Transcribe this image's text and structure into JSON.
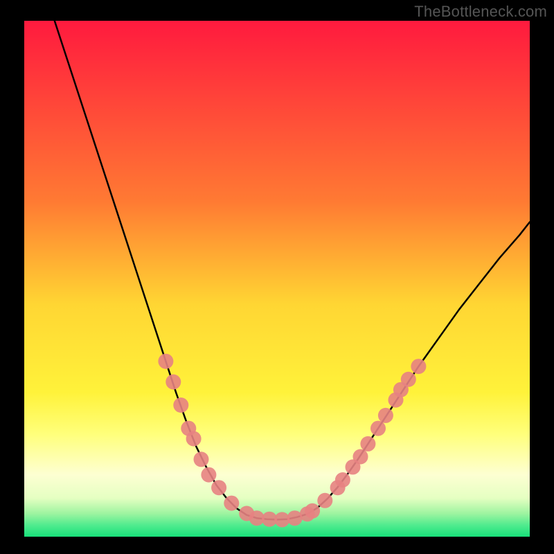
{
  "watermark": "TheBottleneck.com",
  "chart_data": {
    "type": "line",
    "title": "",
    "xlabel": "",
    "ylabel": "",
    "xlim": [
      0,
      100
    ],
    "ylim": [
      0,
      100
    ],
    "grid": false,
    "legend": false,
    "background_gradient": {
      "direction": "vertical",
      "stops": [
        {
          "pos": 0.0,
          "color": "#ff1a3e"
        },
        {
          "pos": 0.35,
          "color": "#ff7a33"
        },
        {
          "pos": 0.55,
          "color": "#ffd633"
        },
        {
          "pos": 0.72,
          "color": "#fff23a"
        },
        {
          "pos": 0.8,
          "color": "#ffff7a"
        },
        {
          "pos": 0.88,
          "color": "#fdffd2"
        },
        {
          "pos": 0.925,
          "color": "#e5ffc2"
        },
        {
          "pos": 0.955,
          "color": "#9ef4a0"
        },
        {
          "pos": 0.978,
          "color": "#4feb8e"
        },
        {
          "pos": 1.0,
          "color": "#18e07a"
        }
      ]
    },
    "series": [
      {
        "name": "left-curve",
        "color": "#000000",
        "x": [
          6,
          10,
          14,
          18,
          22,
          26,
          28,
          30,
          32,
          34,
          36,
          38,
          40,
          42,
          44,
          46
        ],
        "y": [
          100,
          88,
          76,
          64,
          52,
          40,
          34,
          28,
          22.5,
          17.5,
          13.5,
          10,
          7.5,
          5.5,
          4.2,
          3.6
        ]
      },
      {
        "name": "bottom-flat",
        "color": "#000000",
        "x": [
          46,
          48,
          50,
          52,
          54,
          56
        ],
        "y": [
          3.6,
          3.4,
          3.3,
          3.4,
          3.8,
          4.4
        ]
      },
      {
        "name": "right-curve",
        "color": "#000000",
        "x": [
          56,
          58,
          60,
          62,
          64,
          66,
          70,
          74,
          78,
          82,
          86,
          90,
          94,
          98,
          100
        ],
        "y": [
          4.4,
          5.6,
          7.4,
          9.6,
          12.2,
          15,
          21,
          27,
          33,
          38.5,
          44,
          49,
          54,
          58.5,
          61
        ]
      }
    ],
    "scatter": {
      "name": "markers",
      "color": "#e78282",
      "radius": 11,
      "points": [
        {
          "x": 28.0,
          "y": 34.0
        },
        {
          "x": 29.5,
          "y": 30.0
        },
        {
          "x": 31.0,
          "y": 25.5
        },
        {
          "x": 32.5,
          "y": 21.0
        },
        {
          "x": 33.5,
          "y": 19.0
        },
        {
          "x": 35.0,
          "y": 15.0
        },
        {
          "x": 36.5,
          "y": 12.0
        },
        {
          "x": 38.5,
          "y": 9.5
        },
        {
          "x": 41.0,
          "y": 6.5
        },
        {
          "x": 44.0,
          "y": 4.5
        },
        {
          "x": 46.0,
          "y": 3.6
        },
        {
          "x": 48.5,
          "y": 3.4
        },
        {
          "x": 51.0,
          "y": 3.3
        },
        {
          "x": 53.5,
          "y": 3.6
        },
        {
          "x": 56.0,
          "y": 4.4
        },
        {
          "x": 57.0,
          "y": 5.0
        },
        {
          "x": 59.5,
          "y": 7.0
        },
        {
          "x": 62.0,
          "y": 9.5
        },
        {
          "x": 63.0,
          "y": 11.0
        },
        {
          "x": 65.0,
          "y": 13.5
        },
        {
          "x": 66.5,
          "y": 15.5
        },
        {
          "x": 68.0,
          "y": 18.0
        },
        {
          "x": 70.0,
          "y": 21.0
        },
        {
          "x": 71.5,
          "y": 23.5
        },
        {
          "x": 73.5,
          "y": 26.5
        },
        {
          "x": 74.5,
          "y": 28.5
        },
        {
          "x": 76.0,
          "y": 30.5
        },
        {
          "x": 78.0,
          "y": 33.0
        }
      ]
    }
  }
}
